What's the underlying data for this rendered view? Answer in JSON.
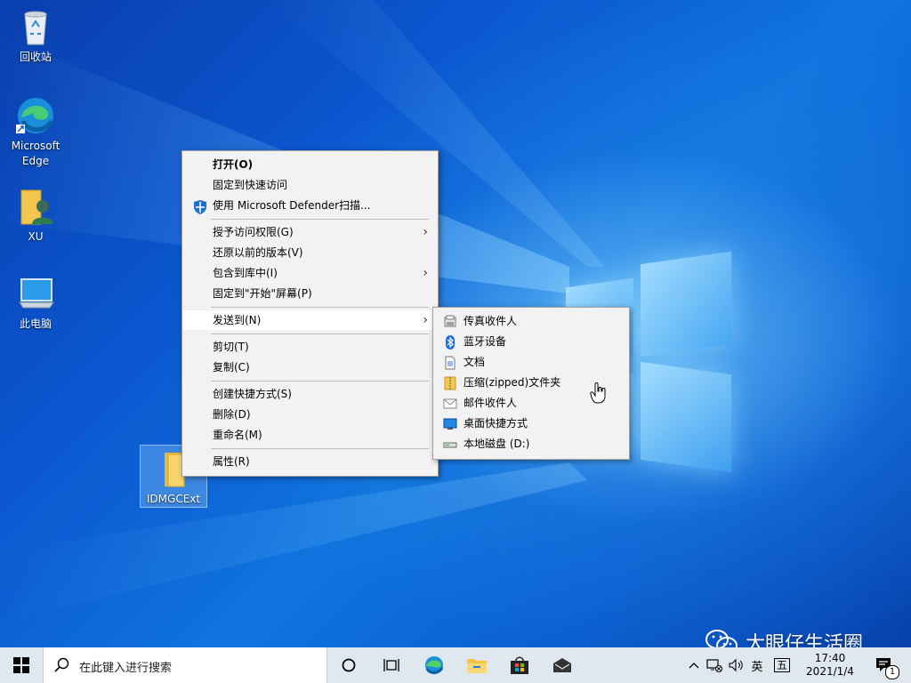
{
  "desktop": {
    "icons": [
      {
        "label": "回收站"
      },
      {
        "label": "Microsoft\nEdge",
        "line1": "Microsoft",
        "line2": "Edge"
      },
      {
        "label": "XU"
      },
      {
        "label": "此电脑"
      },
      {
        "label": "IDMGCExt"
      }
    ]
  },
  "context_menu": {
    "items": [
      {
        "label": "打开(O)",
        "bold": true
      },
      {
        "label": "固定到快速访问"
      },
      {
        "label": "使用 Microsoft Defender扫描...",
        "icon": "defender-shield-icon"
      },
      {
        "label": "授予访问权限(G)",
        "submenu": true
      },
      {
        "label": "还原以前的版本(V)"
      },
      {
        "label": "包含到库中(I)",
        "submenu": true
      },
      {
        "label": "固定到\"开始\"屏幕(P)"
      },
      {
        "label": "发送到(N)",
        "submenu": true,
        "highlighted": true
      },
      {
        "label": "剪切(T)"
      },
      {
        "label": "复制(C)"
      },
      {
        "label": "创建快捷方式(S)"
      },
      {
        "label": "删除(D)"
      },
      {
        "label": "重命名(M)"
      },
      {
        "label": "属性(R)"
      }
    ],
    "arrow": "›"
  },
  "send_to_menu": {
    "items": [
      {
        "label": "传真收件人",
        "icon": "fax-icon"
      },
      {
        "label": "蓝牙设备",
        "icon": "bluetooth-icon"
      },
      {
        "label": "文档",
        "icon": "document-icon"
      },
      {
        "label": "压缩(zipped)文件夹",
        "icon": "zip-folder-icon"
      },
      {
        "label": "邮件收件人",
        "icon": "mail-icon"
      },
      {
        "label": "桌面快捷方式",
        "icon": "desktop-icon"
      },
      {
        "label": "本地磁盘 (D:)",
        "icon": "drive-icon"
      }
    ]
  },
  "taskbar": {
    "search_placeholder": "在此键入进行搜索",
    "tray": {
      "lang": "英",
      "ime": "五",
      "time": "17:40",
      "date": "2021/1/4",
      "notification_count": "1"
    }
  },
  "watermark": {
    "text": "大眼仔生活圈"
  },
  "colors": {
    "accent": "#0078d7",
    "menu_bg": "#f2f2f2",
    "taskbar_bg": "#dfe7ef"
  }
}
